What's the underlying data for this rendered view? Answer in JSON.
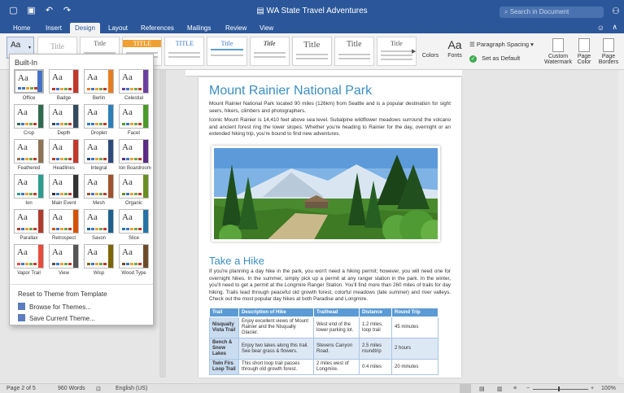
{
  "window": {
    "title": "WA State Travel Adventures"
  },
  "search": {
    "placeholder": "Search in Document"
  },
  "tabs": [
    "Home",
    "Insert",
    "Design",
    "Layout",
    "References",
    "Mailings",
    "Review",
    "View"
  ],
  "active_tab": "Design",
  "ribbon": {
    "gallery": [
      "Title",
      "Title",
      "TITLE",
      "TITLE",
      "Title",
      "Title",
      "Title",
      "Title",
      "Title"
    ],
    "colors_label": "Colors",
    "fonts_label": "Fonts",
    "fonts_glyph": "Aa",
    "paragraph_spacing": "Paragraph Spacing",
    "set_default": "Set as Default",
    "watermark": "Custom Watermark",
    "page_color": "Page Color",
    "page_borders": "Page Borders",
    "accent_colors": [
      "#3a78c6",
      "#f0a030",
      "#6aa84f",
      "#c0392b"
    ]
  },
  "theme_panel": {
    "header": "Built-In",
    "themes": [
      {
        "name": "Office",
        "side": "#4472c4"
      },
      {
        "name": "Badge",
        "side": "#c0392b"
      },
      {
        "name": "Berlin",
        "side": "#e67e22"
      },
      {
        "name": "Celestial",
        "side": "#6b3fa0"
      },
      {
        "name": "Crop",
        "side": "#2e6b4f"
      },
      {
        "name": "Depth",
        "side": "#34495e"
      },
      {
        "name": "Droplet",
        "side": "#2c7fb8"
      },
      {
        "name": "Facet",
        "side": "#4c9a2a"
      },
      {
        "name": "Feathered",
        "side": "#8e7455"
      },
      {
        "name": "Headlines",
        "side": "#c0392b"
      },
      {
        "name": "Integral",
        "side": "#2e4a7d"
      },
      {
        "name": "Ion Boardroom",
        "side": "#5b2c83"
      },
      {
        "name": "Ion",
        "side": "#2a9d8f"
      },
      {
        "name": "Main Event",
        "side": "#333333"
      },
      {
        "name": "Mesh",
        "side": "#a0522d"
      },
      {
        "name": "Organic",
        "side": "#6b8e23"
      },
      {
        "name": "Parallax",
        "side": "#b03a2e"
      },
      {
        "name": "Retrospect",
        "side": "#d35400"
      },
      {
        "name": "Savon",
        "side": "#1f618d"
      },
      {
        "name": "Slice",
        "side": "#2874a6"
      },
      {
        "name": "Vapor Trail",
        "side": "#e74c3c"
      },
      {
        "name": "View",
        "side": "#555555"
      },
      {
        "name": "Wisp",
        "side": "#7d6608"
      },
      {
        "name": "Wood Type",
        "side": "#6e4b2a"
      }
    ],
    "actions": [
      "Reset to Theme from Template",
      "Browse for Themes...",
      "Save Current Theme..."
    ]
  },
  "document": {
    "heading1": "Mount Rainier National Park",
    "para1": "Mount Rainier National Park located 90 miles (126km) from Seattle and is a popular destination for sight seers, hikers, climbers and photographers.",
    "para2": "Iconic Mount Rainier is 14,410 feet above sea level. Subalpine wildflower meadows surround the volcano and ancient forest ring the lower slopes. Whether you're heading to Rainier for the day, overnight or an extended hiking trip, you're bound to find new adventures.",
    "heading2": "Take a Hike",
    "para3": "If you're planning a day hike in the park, you won't need a hiking permit; however, you will need one for overnight hikes. In the summer, simply pick up a permit at any ranger station in the park. In the winter, you'll need to get a permit at the Longmire Ranger Station. You'll find more than 260 miles of trails for day hiking. Trails lead through peaceful old growth forest, colorful meadows (late summer) and river valleys. Check out the most popular day hikes at both Paradise and Longmire.",
    "table": {
      "headers": [
        "Trail",
        "Description of Hike",
        "Trailhead",
        "Distance",
        "Round Trip"
      ],
      "rows": [
        [
          "Nisqually Vista Trail",
          "Enjoy excellent views of Mount Rainier and the Nisqually Glacier.",
          "West end of the lower parking lot.",
          "1.2 miles, loop trail",
          "45 minutes"
        ],
        [
          "Bench & Snow Lakes",
          "Enjoy two lakes along this trail. See bear grass & flowers.",
          "Stevens Canyon Road.",
          "2.5 miles roundtrip",
          "2 hours"
        ],
        [
          "Twin Firs Loop Trail",
          "This short loop trail passes through old growth forest.",
          "2 miles west of Longmire.",
          "0.4 miles",
          "20 minutes"
        ]
      ]
    }
  },
  "status": {
    "page": "Page 2 of 5",
    "words": "960 Words",
    "language": "English (US)",
    "zoom": "100%"
  }
}
